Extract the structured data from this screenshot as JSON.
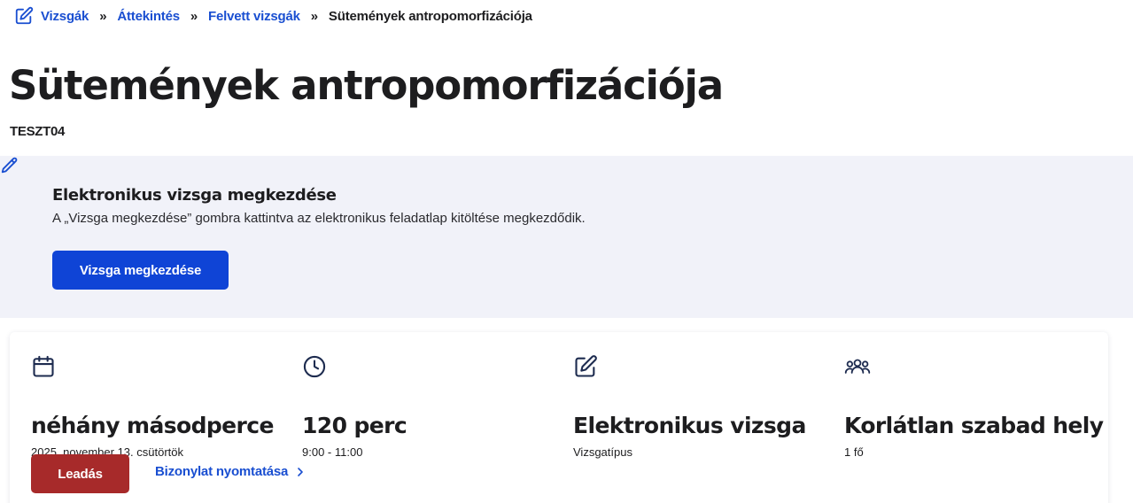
{
  "breadcrumb": {
    "items": [
      {
        "label": "Vizsgák"
      },
      {
        "label": "Áttekintés"
      },
      {
        "label": "Felvett vizsgák"
      }
    ],
    "separator": "»",
    "current": "Sütemények antropomorfizációja"
  },
  "page": {
    "title": "Sütemények antropomorfizációja",
    "code": "TESZT04"
  },
  "notice": {
    "title": "Elektronikus vizsga megkezdése",
    "text": "A „Vizsga megkezdése” gombra kattintva az elektronikus feladatlap kitöltése megkezdődik.",
    "button": "Vizsga megkezdése"
  },
  "details": {
    "items": [
      {
        "icon": "calendar-icon",
        "value": "néhány másodperce",
        "sub": "2025. november 13. csütörtök"
      },
      {
        "icon": "clock-icon",
        "value": "120 perc",
        "sub": "9:00 - 11:00"
      },
      {
        "icon": "edit-icon",
        "value": "Elektronikus vizsga",
        "sub": "Vizsgatípus"
      },
      {
        "icon": "users-icon",
        "value": "Korlátlan szabad hely",
        "sub": "1 fő"
      }
    ],
    "submit_button": "Leadás",
    "receipt_link": "Bizonylat nyomtatása"
  },
  "colors": {
    "primary": "#0f44d6",
    "link": "#1a4fd1",
    "danger": "#a72a2a",
    "notice_bg": "#f1f2f9",
    "text": "#1d1d1f"
  }
}
